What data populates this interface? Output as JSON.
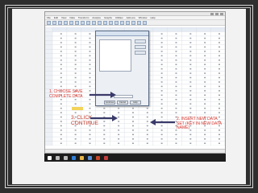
{
  "annotations": {
    "step1": "1. CHOOSE SAVE COMPLETE DATA",
    "step2": "2. INSERT NEW DATA SET (KEY IN NEW DATA NAME)",
    "step3": "3. CLICK CONTINUE"
  },
  "colors": {
    "annotation": "#d9352c",
    "arrow": "#3a3a6a",
    "highlight": "#f3d35a"
  },
  "spss": {
    "menus": [
      "File",
      "Edit",
      "View",
      "Data",
      "Transform",
      "Analyze",
      "Graphs",
      "Utilities",
      "Add-ons",
      "Window",
      "Help"
    ],
    "row_count": 26,
    "column_count": 12
  },
  "dialog": {
    "list_items": [
      "",
      "",
      "",
      "",
      "",
      "",
      "",
      ""
    ],
    "buttons": [
      "Continue",
      "Cancel",
      "Help"
    ]
  },
  "taskbar": {
    "icons": [
      "windows-icon",
      "search-icon",
      "task-view-icon",
      "edge-icon",
      "explorer-icon",
      "store-icon",
      "powerpoint-icon",
      "spss-icon"
    ]
  }
}
